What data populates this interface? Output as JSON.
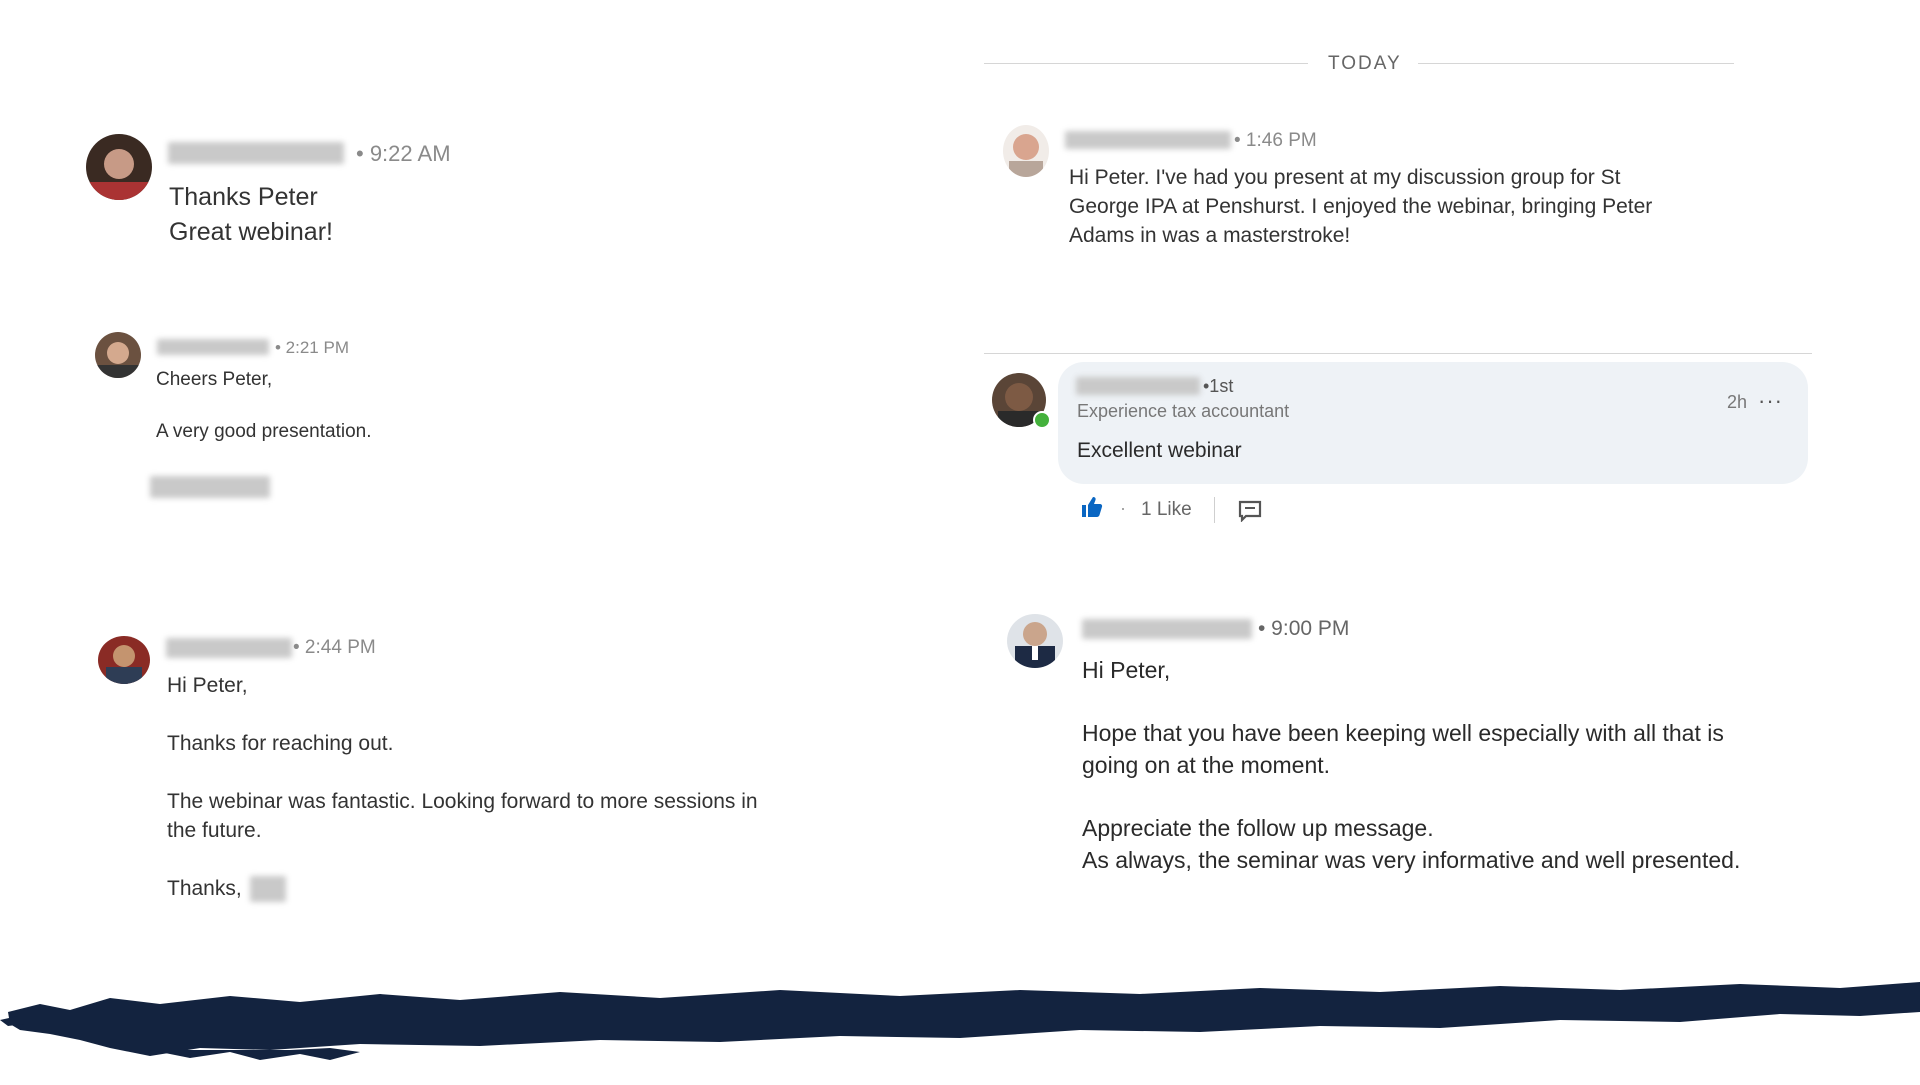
{
  "divider": {
    "label": "TODAY"
  },
  "messages_left": [
    {
      "time": "• 9:22 AM",
      "lines": [
        "Thanks Peter",
        "Great webinar!"
      ]
    },
    {
      "time": "• 2:21 PM",
      "lines": [
        "Cheers Peter,",
        "A very good presentation."
      ]
    },
    {
      "time": "• 2:44 PM",
      "lines": [
        "Hi Peter,",
        "Thanks for reaching out.",
        "The webinar was fantastic. Looking forward to more sessions in",
        "the future.",
        "Thanks,"
      ]
    }
  ],
  "messages_right": [
    {
      "time": "• 1:46 PM",
      "lines": [
        "Hi Peter. I've had you present at my discussion group for St",
        "George IPA at Penshurst. I enjoyed the webinar, bringing Peter",
        "Adams in was a masterstroke!"
      ]
    },
    {
      "time": "• 9:00 PM",
      "lines": [
        "Hi Peter,",
        "Hope that you have been keeping well especially with all that is",
        "going on at the moment.",
        "Appreciate the follow up message.",
        "As always, the seminar was very informative and well presented."
      ]
    }
  ],
  "comment": {
    "degree": "•1st",
    "headline": "Experience tax accountant",
    "time": "2h",
    "more": "···",
    "text": "Excellent webinar",
    "separator": "·",
    "likes": "1 Like",
    "icons": {
      "like": "thumbs-up-icon",
      "reply": "comment-icon",
      "status": "online-status-icon"
    }
  },
  "colors": {
    "brush": "#13233f",
    "like_blue": "#0a66c2",
    "online": "#44b13c",
    "card": "#eef2f6"
  }
}
